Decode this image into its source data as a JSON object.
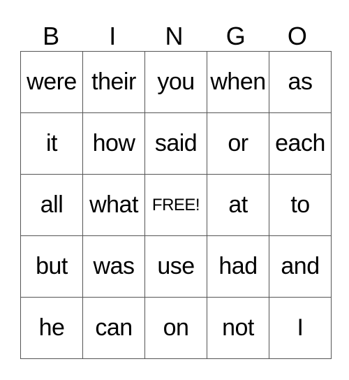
{
  "header": [
    "B",
    "I",
    "N",
    "G",
    "O"
  ],
  "rows": [
    [
      "were",
      "their",
      "you",
      "when",
      "as"
    ],
    [
      "it",
      "how",
      "said",
      "or",
      "each"
    ],
    [
      "all",
      "what",
      "FREE!",
      "at",
      "to"
    ],
    [
      "but",
      "was",
      "use",
      "had",
      "and"
    ],
    [
      "he",
      "can",
      "on",
      "not",
      "I"
    ]
  ],
  "free_cell": {
    "row": 2,
    "col": 2
  }
}
